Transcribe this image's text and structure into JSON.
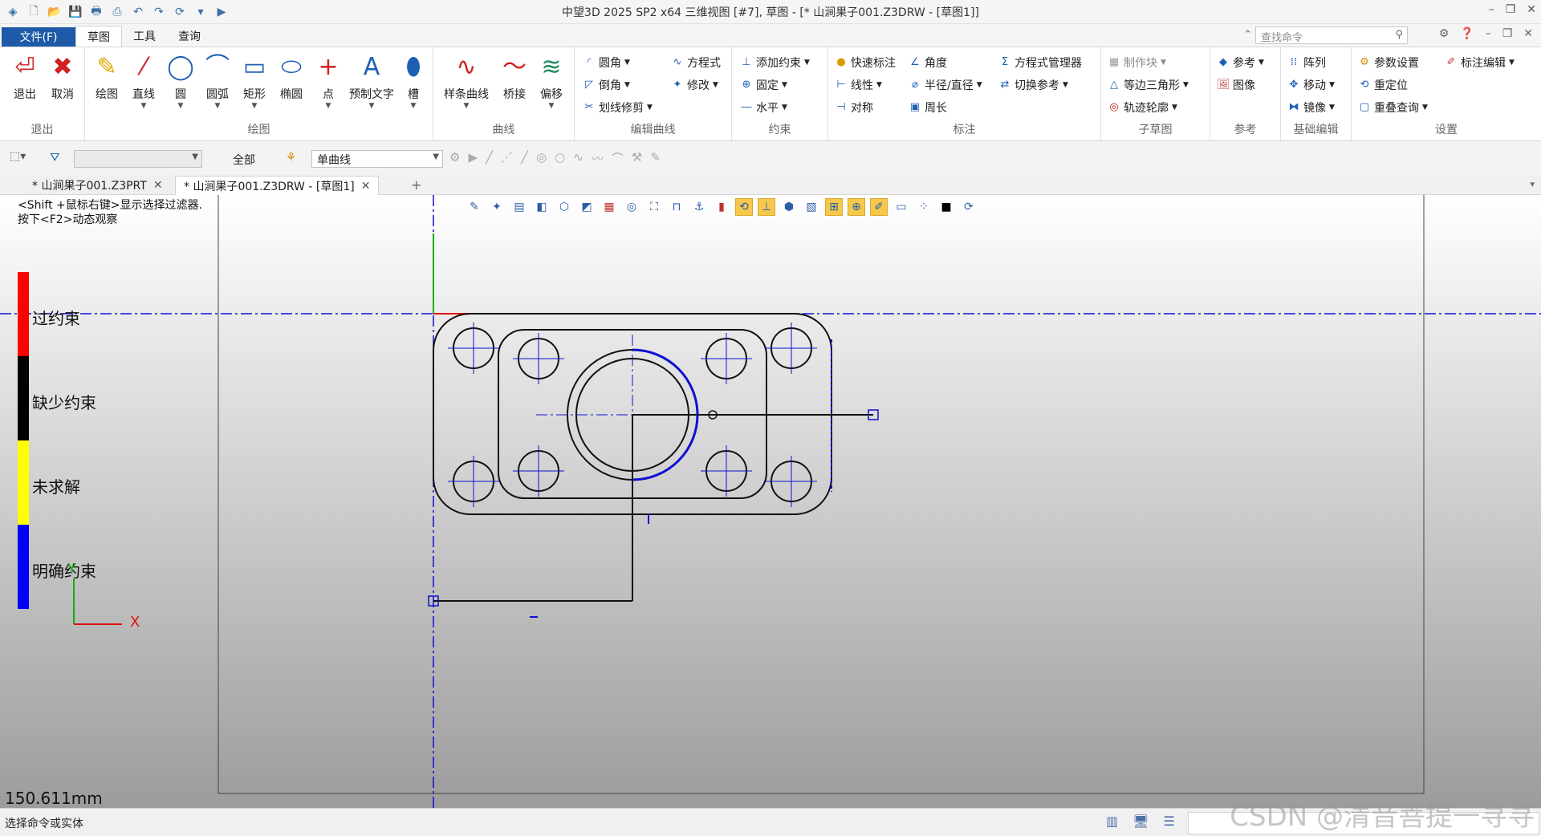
{
  "app": {
    "title": "中望3D 2025 SP2 x64        三维视图 [#7],  草图 - [* 山涧果子001.Z3DRW - [草图1]]",
    "win_controls": [
      "–",
      "❐",
      "✕"
    ]
  },
  "menu": {
    "file": "文件(F)",
    "tabs": [
      "草图",
      "工具",
      "查询"
    ],
    "search_placeholder": "查找命令"
  },
  "ribbon": {
    "exit": {
      "label": "退出",
      "buttons": [
        "退出",
        "取消"
      ]
    },
    "draw": {
      "label": "绘图",
      "buttons": [
        "绘图",
        "直线",
        "圆",
        "圆弧",
        "矩形",
        "椭圆",
        "点",
        "预制文字",
        "槽"
      ]
    },
    "curve": {
      "label": "曲线",
      "buttons": [
        "样条曲线",
        "桥接",
        "偏移"
      ]
    },
    "edit_curve": {
      "label": "编辑曲线",
      "items": [
        "圆角",
        "倒角",
        "划线修剪",
        "方程式",
        "修改"
      ]
    },
    "constraint": {
      "label": "约束",
      "items": [
        "添加约束",
        "固定",
        "水平"
      ]
    },
    "dimension": {
      "label": "标注",
      "items": [
        "快速标注",
        "线性",
        "对称",
        "角度",
        "半径/直径",
        "周长",
        "方程式管理器",
        "切换参考"
      ]
    },
    "subsketch": {
      "label": "子草图",
      "items": [
        "制作块",
        "等边三角形",
        "轨迹轮廓"
      ]
    },
    "reference": {
      "label": "参考",
      "items": [
        "参考",
        "图像"
      ]
    },
    "basic_edit": {
      "label": "基础编辑",
      "items": [
        "阵列",
        "移动",
        "镜像"
      ]
    },
    "settings": {
      "label": "设置",
      "items": [
        "参数设置",
        "重定位",
        "重叠查询",
        "标注编辑"
      ]
    }
  },
  "toolrow": {
    "filter_all": "全部",
    "curve_mode": "单曲线"
  },
  "doc_tabs": [
    {
      "label": "* 山涧果子001.Z3PRT"
    },
    {
      "label": "* 山涧果子001.Z3DRW - [草图1]"
    }
  ],
  "canvas": {
    "hint_line1": "<Shift +鼠标右键>显示选择过滤器.",
    "hint_line2": "按下<F2>动态观察",
    "legend": [
      {
        "label": "过约束",
        "color": "#ff0000"
      },
      {
        "label": "缺少约束",
        "color": "#000000"
      },
      {
        "label": "未求解",
        "color": "#ffff00"
      },
      {
        "label": "明确约束",
        "color": "#0000ff"
      }
    ],
    "axis_x": "X",
    "axis_y": "Y",
    "distance": "150.611mm"
  },
  "status": {
    "text": "选择命令或实体"
  },
  "watermark": "CSDN @清音菩提一寻寻"
}
